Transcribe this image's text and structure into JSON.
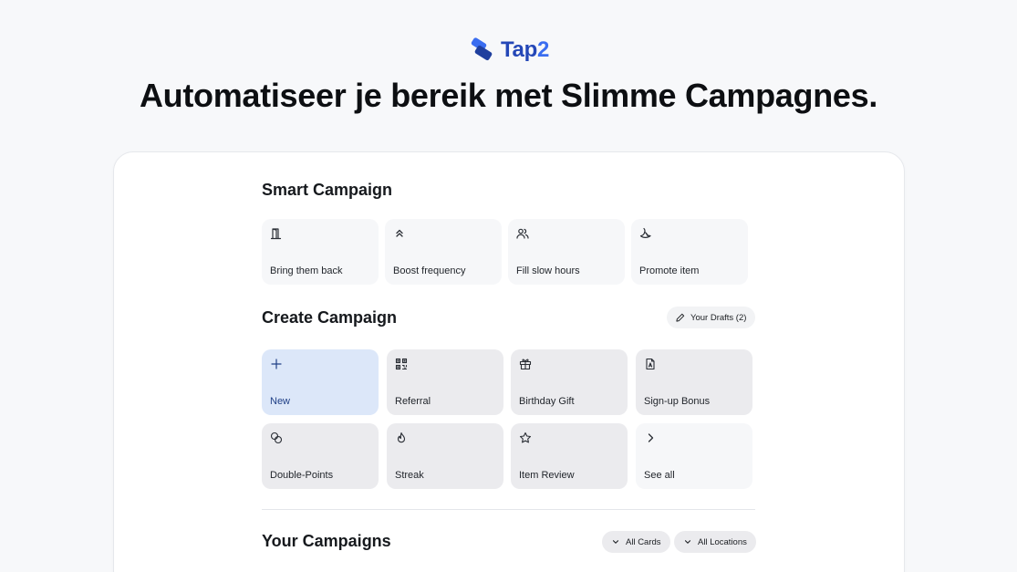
{
  "brand": {
    "name": "Tap",
    "name_suffix": "2",
    "logo_icon": "tap2-logo-icon",
    "color": "#2447b7"
  },
  "headline": "Automatiseer je bereik met Slimme Campagnes.",
  "smart_campaign": {
    "title": "Smart Campaign",
    "items": [
      {
        "label": "Bring them back",
        "icon": "door-icon"
      },
      {
        "label": "Boost frequency",
        "icon": "chevrons-up-icon"
      },
      {
        "label": "Fill slow hours",
        "icon": "users-icon"
      },
      {
        "label": "Promote item",
        "icon": "banana-icon"
      }
    ]
  },
  "create_campaign": {
    "title": "Create Campaign",
    "drafts_label": "Your Drafts (2)",
    "items": [
      {
        "label": "New",
        "icon": "plus-icon"
      },
      {
        "label": "Referral",
        "icon": "qr-code-icon"
      },
      {
        "label": "Birthday Gift",
        "icon": "gift-icon"
      },
      {
        "label": "Sign-up Bonus",
        "icon": "document-icon"
      },
      {
        "label": "Double-Points",
        "icon": "coins-icon"
      },
      {
        "label": "Streak",
        "icon": "flame-icon"
      },
      {
        "label": "Item Review",
        "icon": "star-icon"
      },
      {
        "label": "See all",
        "icon": "chevron-right-icon"
      }
    ]
  },
  "your_campaigns": {
    "title": "Your Campaigns",
    "filters": [
      {
        "label": "All Cards",
        "icon": "chevron-down-icon"
      },
      {
        "label": "All Locations",
        "icon": "chevron-down-icon"
      }
    ]
  },
  "colors": {
    "accent": "#3a6df0",
    "new_tile": "#dce7f9",
    "tile": "#ebebee",
    "background": "#f7f8fa"
  }
}
